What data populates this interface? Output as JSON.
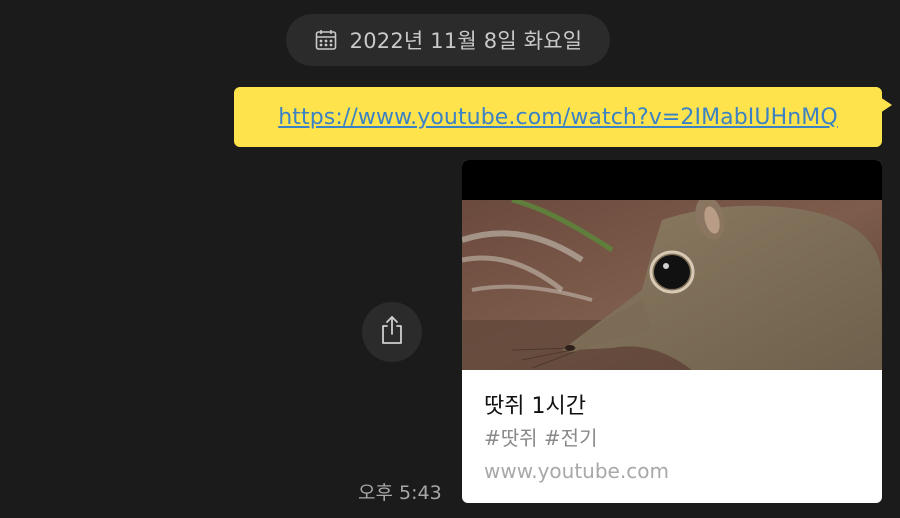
{
  "date_divider": {
    "text": "2022년 11월 8일 화요일",
    "icon": "calendar-icon"
  },
  "message": {
    "link_text": "https://www.youtube.com/watch?v=2IMabIUHnMQ",
    "time": "오후 5:43",
    "bubble_color": "#fee34d",
    "link_color": "#3b82c4"
  },
  "share": {
    "icon": "share-icon"
  },
  "preview": {
    "title": "땃쥐 1시간",
    "tags": "#땃쥐 #전기",
    "domain": "www.youtube.com",
    "thumbnail": "elephant-shrew-image"
  }
}
